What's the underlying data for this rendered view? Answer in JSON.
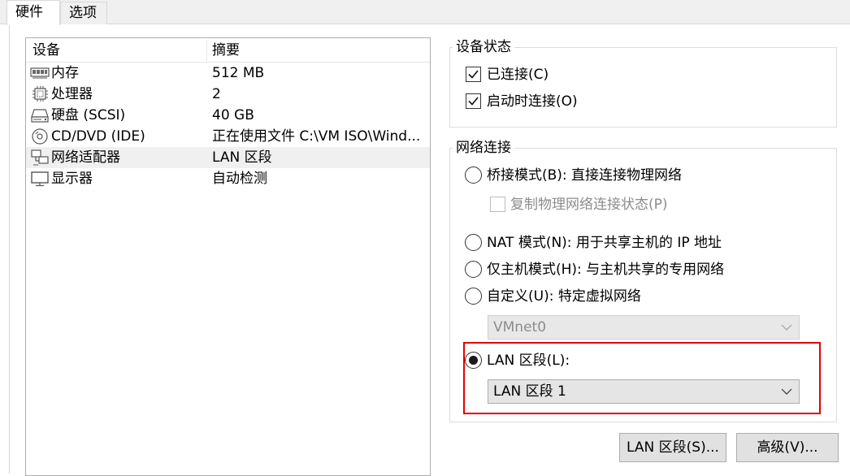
{
  "tabs": [
    {
      "label": "硬件",
      "active": true
    },
    {
      "label": "选项",
      "active": false
    }
  ],
  "device_list": {
    "headers": {
      "device": "设备",
      "summary": "摘要"
    },
    "rows": [
      {
        "icon": "memory-icon",
        "name": "内存",
        "summary": "512 MB",
        "selected": false
      },
      {
        "icon": "processor-icon",
        "name": "处理器",
        "summary": "2",
        "selected": false
      },
      {
        "icon": "hard-disk-icon",
        "name": "硬盘 (SCSI)",
        "summary": "40 GB",
        "selected": false
      },
      {
        "icon": "cd-dvd-icon",
        "name": "CD/DVD (IDE)",
        "summary": "正在使用文件 C:\\VM ISO\\Wind...",
        "selected": false
      },
      {
        "icon": "network-adapter-icon",
        "name": "网络适配器",
        "summary": "LAN 区段",
        "selected": true
      },
      {
        "icon": "display-icon",
        "name": "显示器",
        "summary": "自动检测",
        "selected": false
      }
    ]
  },
  "device_status": {
    "title": "设备状态",
    "connected": {
      "label": "已连接(C)",
      "checked": true
    },
    "connect_at_power_on": {
      "label": "启动时连接(O)",
      "checked": true
    }
  },
  "network_connection": {
    "title": "网络连接",
    "bridged": {
      "label": "桥接模式(B): 直接连接物理网络",
      "selected": false
    },
    "replicate_state": {
      "label": "复制物理网络连接状态(P)",
      "checked": false,
      "disabled": true
    },
    "nat": {
      "label": "NAT 模式(N): 用于共享主机的 IP 地址",
      "selected": false
    },
    "host_only": {
      "label": "仅主机模式(H): 与主机共享的专用网络",
      "selected": false
    },
    "custom": {
      "label": "自定义(U): 特定虚拟网络",
      "selected": false
    },
    "custom_select": {
      "value": "VMnet0",
      "disabled": true
    },
    "lan_segment": {
      "label": "LAN 区段(L):",
      "selected": true
    },
    "lan_segment_select": {
      "value": "LAN 区段 1"
    }
  },
  "buttons": {
    "lan_segments": "LAN 区段(S)...",
    "advanced": "高级(V)..."
  },
  "colors": {
    "highlight": "#e30000",
    "selected_row": "#f0f0f0"
  }
}
